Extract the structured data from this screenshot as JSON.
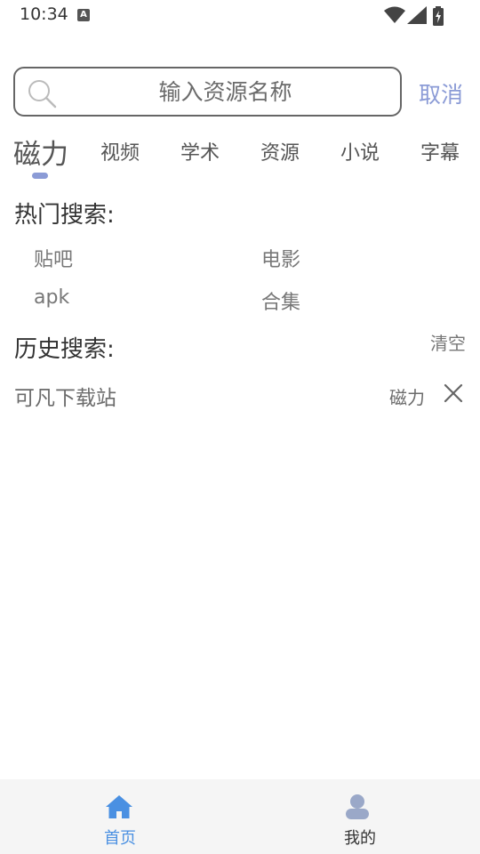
{
  "status_bar": {
    "time": "10:34",
    "notification_icon": "A",
    "icons": [
      "wifi-icon",
      "signal-icon",
      "battery-charging-icon"
    ]
  },
  "search": {
    "placeholder": "输入资源名称",
    "value": "",
    "cancel_label": "取消"
  },
  "tabs": [
    {
      "label": "磁力",
      "active": true
    },
    {
      "label": "视频",
      "active": false
    },
    {
      "label": "学术",
      "active": false
    },
    {
      "label": "资源",
      "active": false
    },
    {
      "label": "小说",
      "active": false
    },
    {
      "label": "字幕",
      "active": false
    }
  ],
  "hot_search": {
    "title": "热门搜索:",
    "items": [
      "贴吧",
      "电影",
      "apk",
      "合集"
    ]
  },
  "history": {
    "title": "历史搜索:",
    "clear_label": "清空",
    "items": [
      {
        "text": "可凡下载站",
        "type": "磁力"
      }
    ]
  },
  "bottom_nav": {
    "items": [
      {
        "label": "首页",
        "icon": "home-icon",
        "active": true
      },
      {
        "label": "我的",
        "icon": "user-icon",
        "active": false
      }
    ]
  },
  "colors": {
    "accent": "#8b9bd6",
    "nav_active": "#4a90e2",
    "nav_inactive": "#333333",
    "text": "#555555"
  }
}
